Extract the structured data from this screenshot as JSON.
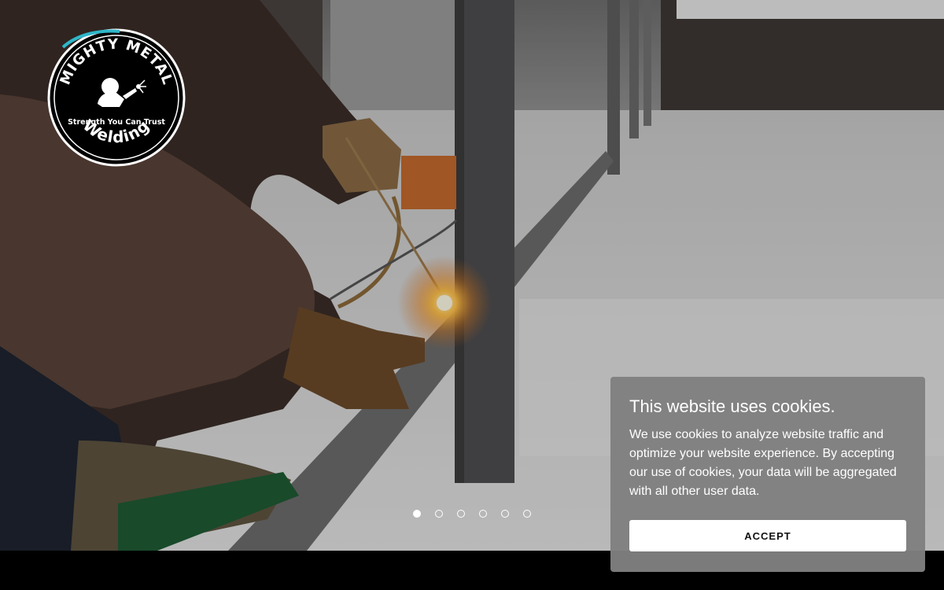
{
  "logo": {
    "top_text": "MIGHTY METAL",
    "tagline": "Strength You Can Trust",
    "bottom_text": "Welding"
  },
  "slider": {
    "total_slides": 6,
    "active_index": 0
  },
  "cookie_banner": {
    "title": "This website uses cookies.",
    "body": "We use cookies to analyze website traffic and optimize your website experience. By accepting our use of cookies, your data will be aggregated with all other user data.",
    "accept_label": "ACCEPT"
  },
  "colors": {
    "banner_bg": "#808080",
    "button_bg": "#ffffff",
    "footer_bg": "#000000"
  }
}
